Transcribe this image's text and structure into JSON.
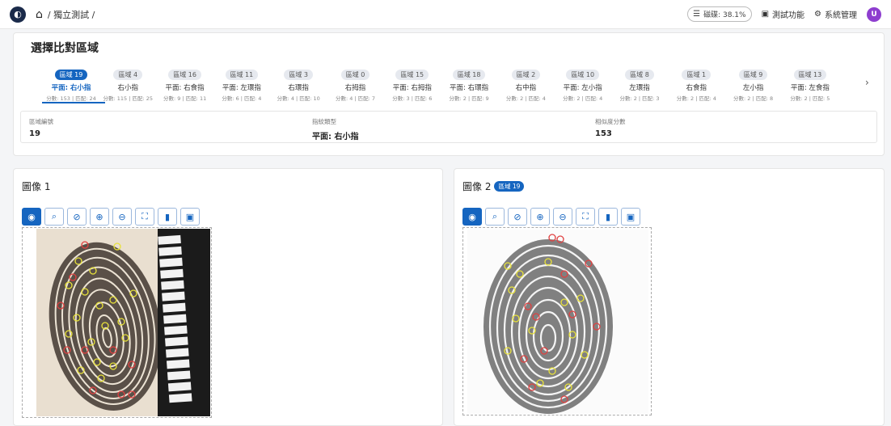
{
  "topbar": {
    "breadcrumb": "/ 獨立測試 /",
    "disk_label": "磁碟: 38.1%",
    "test_label": "測試功能",
    "admin_label": "系統管理",
    "avatar_letter": "U"
  },
  "section": {
    "title": "選擇比對區域"
  },
  "regions": [
    {
      "badge": "區域 19",
      "name": "平面: 右小指",
      "score": "分數: 153 | 匹配: 24",
      "active": true
    },
    {
      "badge": "區域 4",
      "name": "右小指",
      "score": "分數: 115 | 匹配: 25"
    },
    {
      "badge": "區域 16",
      "name": "平面: 右食指",
      "score": "分數: 9 | 匹配: 11"
    },
    {
      "badge": "區域 11",
      "name": "平面: 左環指",
      "score": "分數: 6 | 匹配: 4"
    },
    {
      "badge": "區域 3",
      "name": "右環指",
      "score": "分數: 4 | 匹配: 10"
    },
    {
      "badge": "區域 0",
      "name": "右拇指",
      "score": "分數: 4 | 匹配: 7"
    },
    {
      "badge": "區域 15",
      "name": "平面: 右拇指",
      "score": "分數: 3 | 匹配: 6"
    },
    {
      "badge": "區域 18",
      "name": "平面: 右環指",
      "score": "分數: 2 | 匹配: 9"
    },
    {
      "badge": "區域 2",
      "name": "右中指",
      "score": "分數: 2 | 匹配: 4"
    },
    {
      "badge": "區域 10",
      "name": "平面: 左小指",
      "score": "分數: 2 | 匹配: 4"
    },
    {
      "badge": "區域 8",
      "name": "左環指",
      "score": "分數: 2 | 匹配: 3"
    },
    {
      "badge": "區域 1",
      "name": "右食指",
      "score": "分數: 2 | 匹配: 4"
    },
    {
      "badge": "區域 9",
      "name": "左小指",
      "score": "分數: 2 | 匹配: 8"
    },
    {
      "badge": "區域 13",
      "name": "平面: 左食指",
      "score": "分數: 2 | 匹配: 5"
    }
  ],
  "info": {
    "region_label": "區域編號",
    "region_value": "19",
    "type_label": "指紋類型",
    "type_value": "平面: 右小指",
    "score_label": "相似度分數",
    "score_value": "153"
  },
  "panel1": {
    "title": "圖像 1"
  },
  "panel2": {
    "title": "圖像 2",
    "chip": "區域 19"
  },
  "toolbar_icons": [
    "eye-icon",
    "search-detail-icon",
    "eye-off-icon",
    "zoom-in-icon",
    "zoom-out-icon",
    "fullscreen-icon",
    "trash-icon",
    "save-icon"
  ]
}
